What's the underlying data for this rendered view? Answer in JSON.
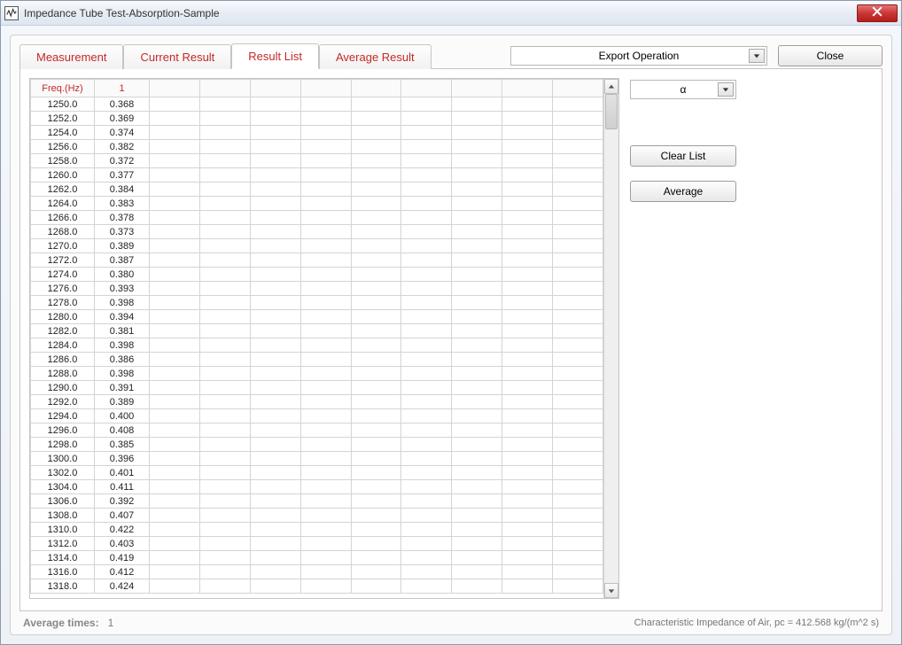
{
  "window": {
    "title": "Impedance Tube Test-Absorption-Sample"
  },
  "tabs": {
    "measurement": "Measurement",
    "current_result": "Current Result",
    "result_list": "Result List",
    "average_result": "Average Result"
  },
  "top_controls": {
    "export_label": "Export Operation",
    "close_label": "Close"
  },
  "table": {
    "header_freq": "Freq.(Hz)",
    "header_col1": "1",
    "rows": [
      {
        "freq": "1250.0",
        "v": "0.368"
      },
      {
        "freq": "1252.0",
        "v": "0.369"
      },
      {
        "freq": "1254.0",
        "v": "0.374"
      },
      {
        "freq": "1256.0",
        "v": "0.382"
      },
      {
        "freq": "1258.0",
        "v": "0.372"
      },
      {
        "freq": "1260.0",
        "v": "0.377"
      },
      {
        "freq": "1262.0",
        "v": "0.384"
      },
      {
        "freq": "1264.0",
        "v": "0.383"
      },
      {
        "freq": "1266.0",
        "v": "0.378"
      },
      {
        "freq": "1268.0",
        "v": "0.373"
      },
      {
        "freq": "1270.0",
        "v": "0.389"
      },
      {
        "freq": "1272.0",
        "v": "0.387"
      },
      {
        "freq": "1274.0",
        "v": "0.380"
      },
      {
        "freq": "1276.0",
        "v": "0.393"
      },
      {
        "freq": "1278.0",
        "v": "0.398"
      },
      {
        "freq": "1280.0",
        "v": "0.394"
      },
      {
        "freq": "1282.0",
        "v": "0.381"
      },
      {
        "freq": "1284.0",
        "v": "0.398"
      },
      {
        "freq": "1286.0",
        "v": "0.386"
      },
      {
        "freq": "1288.0",
        "v": "0.398"
      },
      {
        "freq": "1290.0",
        "v": "0.391"
      },
      {
        "freq": "1292.0",
        "v": "0.389"
      },
      {
        "freq": "1294.0",
        "v": "0.400"
      },
      {
        "freq": "1296.0",
        "v": "0.408"
      },
      {
        "freq": "1298.0",
        "v": "0.385"
      },
      {
        "freq": "1300.0",
        "v": "0.396"
      },
      {
        "freq": "1302.0",
        "v": "0.401"
      },
      {
        "freq": "1304.0",
        "v": "0.411"
      },
      {
        "freq": "1306.0",
        "v": "0.392"
      },
      {
        "freq": "1308.0",
        "v": "0.407"
      },
      {
        "freq": "1310.0",
        "v": "0.422"
      },
      {
        "freq": "1312.0",
        "v": "0.403"
      },
      {
        "freq": "1314.0",
        "v": "0.419"
      },
      {
        "freq": "1316.0",
        "v": "0.412"
      },
      {
        "freq": "1318.0",
        "v": "0.424"
      }
    ]
  },
  "side": {
    "param_label": "α",
    "clear_list": "Clear List",
    "average": "Average"
  },
  "footer": {
    "avg_label": "Average times:",
    "avg_value": "1",
    "impedance_text": "Characteristic Impedance of Air, pc = 412.568 kg/(m^2 s)"
  }
}
